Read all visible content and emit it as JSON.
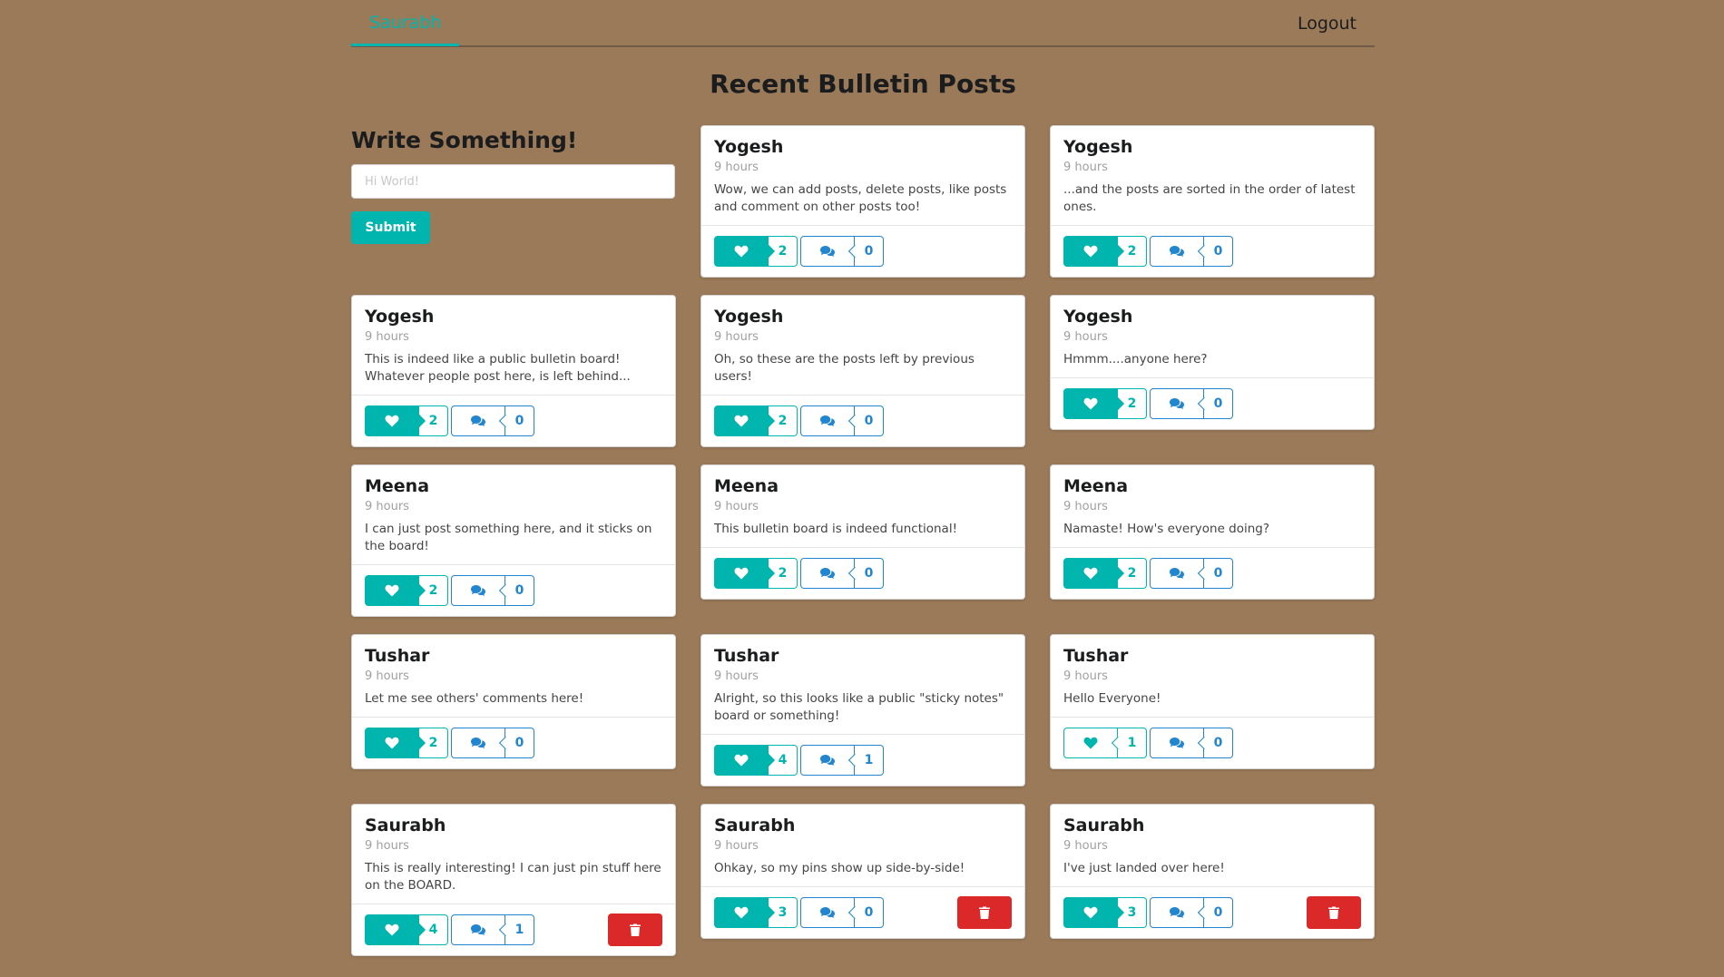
{
  "nav": {
    "user": "Saurabh",
    "logout": "Logout"
  },
  "page_title": "Recent Bulletin Posts",
  "form": {
    "title": "Write Something!",
    "placeholder": "Hi World!",
    "value": "",
    "submit": "Submit"
  },
  "colors": {
    "background": "#9b7a59",
    "teal": "#00b5ad",
    "blue": "#2185d0",
    "red": "#db2828"
  },
  "posts": [
    {
      "author": "Yogesh",
      "time": "9 hours",
      "text": "Wow, we can add posts, delete posts, like posts and comment on other posts too!",
      "likes": "2",
      "comments": "0",
      "liked": true,
      "deletable": false
    },
    {
      "author": "Yogesh",
      "time": "9 hours",
      "text": "...and the posts are sorted in the order of latest ones.",
      "likes": "2",
      "comments": "0",
      "liked": true,
      "deletable": false
    },
    {
      "author": "Yogesh",
      "time": "9 hours",
      "text": "This is indeed like a public bulletin board! Whatever people post here, is left behind...",
      "likes": "2",
      "comments": "0",
      "liked": true,
      "deletable": false
    },
    {
      "author": "Yogesh",
      "time": "9 hours",
      "text": "Oh, so these are the posts left by previous users!",
      "likes": "2",
      "comments": "0",
      "liked": true,
      "deletable": false
    },
    {
      "author": "Yogesh",
      "time": "9 hours",
      "text": "Hmmm....anyone here?",
      "likes": "2",
      "comments": "0",
      "liked": true,
      "deletable": false
    },
    {
      "author": "Meena",
      "time": "9 hours",
      "text": "I can just post something here, and it sticks on the board!",
      "likes": "2",
      "comments": "0",
      "liked": true,
      "deletable": false
    },
    {
      "author": "Meena",
      "time": "9 hours",
      "text": "This bulletin board is indeed functional!",
      "likes": "2",
      "comments": "0",
      "liked": true,
      "deletable": false
    },
    {
      "author": "Meena",
      "time": "9 hours",
      "text": "Namaste! How's everyone doing?",
      "likes": "2",
      "comments": "0",
      "liked": true,
      "deletable": false
    },
    {
      "author": "Tushar",
      "time": "9 hours",
      "text": "Let me see others' comments here!",
      "likes": "2",
      "comments": "0",
      "liked": true,
      "deletable": false
    },
    {
      "author": "Tushar",
      "time": "9 hours",
      "text": "Alright, so this looks like a public \"sticky notes\" board or something!",
      "likes": "4",
      "comments": "1",
      "liked": true,
      "deletable": false
    },
    {
      "author": "Tushar",
      "time": "9 hours",
      "text": "Hello Everyone!",
      "likes": "1",
      "comments": "0",
      "liked": false,
      "deletable": false
    },
    {
      "author": "Saurabh",
      "time": "9 hours",
      "text": "This is really interesting! I can just pin stuff here on the BOARD.",
      "likes": "4",
      "comments": "1",
      "liked": true,
      "deletable": true
    },
    {
      "author": "Saurabh",
      "time": "9 hours",
      "text": "Ohkay, so my pins show up side-by-side!",
      "likes": "3",
      "comments": "0",
      "liked": true,
      "deletable": true
    },
    {
      "author": "Saurabh",
      "time": "9 hours",
      "text": "I've just landed over here!",
      "likes": "3",
      "comments": "0",
      "liked": true,
      "deletable": true
    }
  ]
}
